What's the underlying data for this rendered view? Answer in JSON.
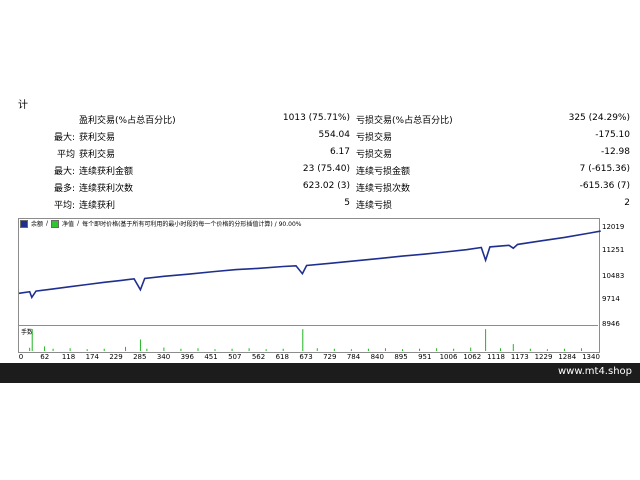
{
  "header": {
    "section_char": "计"
  },
  "stats": {
    "rows": [
      {
        "prefix": "",
        "label": "盈利交易(%占总百分比)",
        "value": "1013 (75.71%)",
        "label2": "亏损交易(%占总百分比)",
        "value2": "325 (24.29%)"
      },
      {
        "prefix": "最大:",
        "label": "获利交易",
        "value": "554.04",
        "label2": "亏损交易",
        "value2": "-175.10"
      },
      {
        "prefix": "平均",
        "label": "获利交易",
        "value": "6.17",
        "label2": "亏损交易",
        "value2": "-12.98"
      },
      {
        "prefix": "最大:",
        "label": "连续获利金额",
        "value": "23 (75.40)",
        "label2": "连续亏损金额",
        "value2": "7 (-615.36)"
      },
      {
        "prefix": "最多:",
        "label": "连续获利次数",
        "value": "623.02 (3)",
        "label2": "连续亏损次数",
        "value2": "-615.36 (7)"
      },
      {
        "prefix": "平均:",
        "label": "连续获利",
        "value": "5",
        "label2": "连续亏损",
        "value2": "2"
      }
    ]
  },
  "chart": {
    "legend": {
      "balance_label": "余额",
      "equity_label": "净值",
      "text": "每个即时价格(基于所有可利用的最小时段的每一个价格的分形插值计算) / 90.00%"
    },
    "volume_label": "手数",
    "colors": {
      "balance": "#1f2f8f",
      "equity": "#2ec62e",
      "volume": "#22b522",
      "frame": "#8c8c8c"
    }
  },
  "chart_data": {
    "type": "line",
    "title": "",
    "xlabel": "",
    "ylabel": "",
    "ylim": [
      8946,
      12019
    ],
    "y_ticks": [
      "12019",
      "11251",
      "10483",
      "9714",
      "8946"
    ],
    "x_ticks": [
      "0",
      "62",
      "118",
      "174",
      "229",
      "285",
      "340",
      "396",
      "451",
      "507",
      "562",
      "618",
      "673",
      "729",
      "784",
      "840",
      "895",
      "951",
      "1006",
      "1062",
      "1118",
      "1173",
      "1229",
      "1284",
      "1340"
    ],
    "xlim": [
      0,
      1340
    ],
    "series": [
      {
        "values": [
          [
            0,
            9950
          ],
          [
            25,
            10000
          ],
          [
            30,
            9820
          ],
          [
            40,
            10020
          ],
          [
            80,
            10090
          ],
          [
            120,
            10160
          ],
          [
            160,
            10230
          ],
          [
            200,
            10300
          ],
          [
            240,
            10360
          ],
          [
            270,
            10410
          ],
          [
            285,
            10060
          ],
          [
            295,
            10420
          ],
          [
            340,
            10490
          ],
          [
            400,
            10560
          ],
          [
            460,
            10640
          ],
          [
            510,
            10700
          ],
          [
            560,
            10740
          ],
          [
            620,
            10800
          ],
          [
            650,
            10820
          ],
          [
            665,
            10570
          ],
          [
            675,
            10830
          ],
          [
            730,
            10900
          ],
          [
            790,
            10980
          ],
          [
            850,
            11060
          ],
          [
            900,
            11130
          ],
          [
            950,
            11190
          ],
          [
            1000,
            11260
          ],
          [
            1050,
            11330
          ],
          [
            1085,
            11400
          ],
          [
            1095,
            11000
          ],
          [
            1105,
            11420
          ],
          [
            1150,
            11470
          ],
          [
            1160,
            11380
          ],
          [
            1170,
            11500
          ],
          [
            1220,
            11600
          ],
          [
            1280,
            11720
          ],
          [
            1340,
            11860
          ],
          [
            1365,
            11920
          ]
        ]
      }
    ],
    "volume": [
      [
        25,
        0.14
      ],
      [
        31,
        0.95
      ],
      [
        60,
        0.2
      ],
      [
        80,
        0.1
      ],
      [
        120,
        0.12
      ],
      [
        160,
        0.08
      ],
      [
        200,
        0.1
      ],
      [
        250,
        0.18
      ],
      [
        285,
        0.5
      ],
      [
        300,
        0.1
      ],
      [
        340,
        0.15
      ],
      [
        380,
        0.1
      ],
      [
        420,
        0.12
      ],
      [
        460,
        0.08
      ],
      [
        500,
        0.1
      ],
      [
        540,
        0.12
      ],
      [
        580,
        0.08
      ],
      [
        620,
        0.1
      ],
      [
        666,
        0.95
      ],
      [
        700,
        0.12
      ],
      [
        740,
        0.1
      ],
      [
        780,
        0.08
      ],
      [
        820,
        0.1
      ],
      [
        860,
        0.12
      ],
      [
        900,
        0.08
      ],
      [
        940,
        0.1
      ],
      [
        980,
        0.12
      ],
      [
        1020,
        0.1
      ],
      [
        1060,
        0.15
      ],
      [
        1095,
        0.95
      ],
      [
        1130,
        0.12
      ],
      [
        1160,
        0.3
      ],
      [
        1200,
        0.1
      ],
      [
        1240,
        0.08
      ],
      [
        1280,
        0.1
      ],
      [
        1320,
        0.12
      ]
    ]
  },
  "footer": {
    "watermark": "www.mt4.shop"
  }
}
